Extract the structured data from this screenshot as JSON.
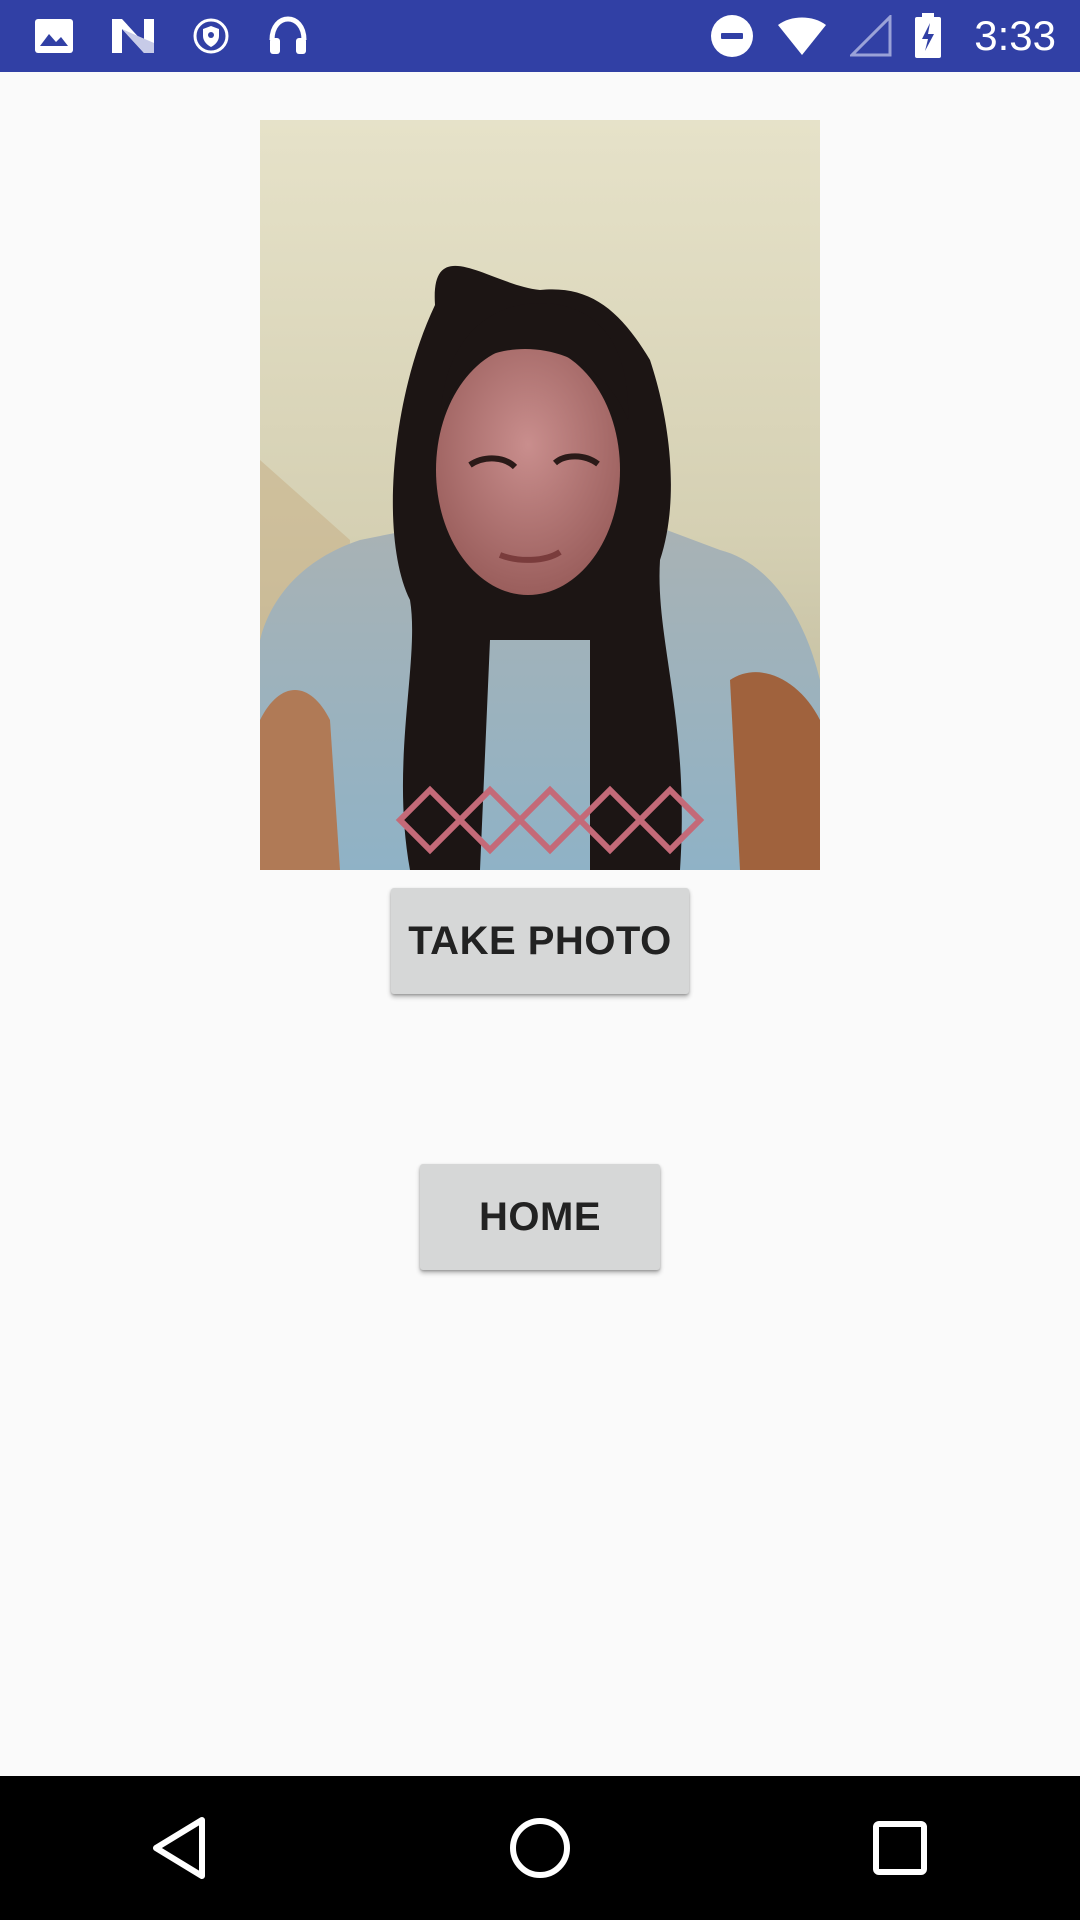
{
  "status_bar": {
    "time": "3:33",
    "left_icons": [
      "image-icon",
      "n-app-icon",
      "vpn-shield-icon",
      "headphones-icon"
    ],
    "right_icons": [
      "do-not-disturb-icon",
      "wifi-icon",
      "cell-signal-icon",
      "battery-charging-icon"
    ],
    "background": "#3140a5"
  },
  "main": {
    "photo_alt": "selfie photo",
    "take_photo_label": "TAKE PHOTO",
    "home_label": "HOME"
  },
  "nav_bar": {
    "back": "back-icon",
    "home": "home-circle-icon",
    "recents": "recents-square-icon"
  }
}
